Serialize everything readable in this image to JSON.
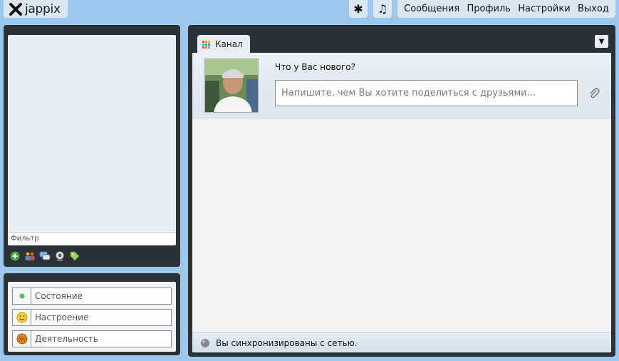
{
  "app": {
    "logo_text": "jappix"
  },
  "topbar": {
    "star_icon": "✱",
    "music_icon": "♫",
    "menu": [
      {
        "label": "Сообщения"
      },
      {
        "label": "Профиль"
      },
      {
        "label": "Настройки"
      },
      {
        "label": "Выход"
      }
    ]
  },
  "roster": {
    "filter_placeholder": "Фильтр",
    "tools": [
      "add-contact-icon",
      "group-chat-icon",
      "muc-join-icon",
      "directory-icon",
      "tag-icon"
    ]
  },
  "status": {
    "rows": [
      {
        "label": "Состояние",
        "icon": "status-dot-icon"
      },
      {
        "label": "Настроение",
        "icon": "mood-smiley-icon"
      },
      {
        "label": "Деятельность",
        "icon": "activity-ball-icon"
      }
    ]
  },
  "channel": {
    "tab_label": "Канал",
    "menu_glyph": "▼",
    "question": "Что у Вас нового?",
    "input_placeholder": "Напишите, чем Вы хотите поделиться с друзьями...",
    "sync_text": "Вы синхронизированы с сетью."
  },
  "colors": {
    "background": "#9cc8ee",
    "panel": "#2c3136",
    "status_green": "#5cb85c"
  }
}
